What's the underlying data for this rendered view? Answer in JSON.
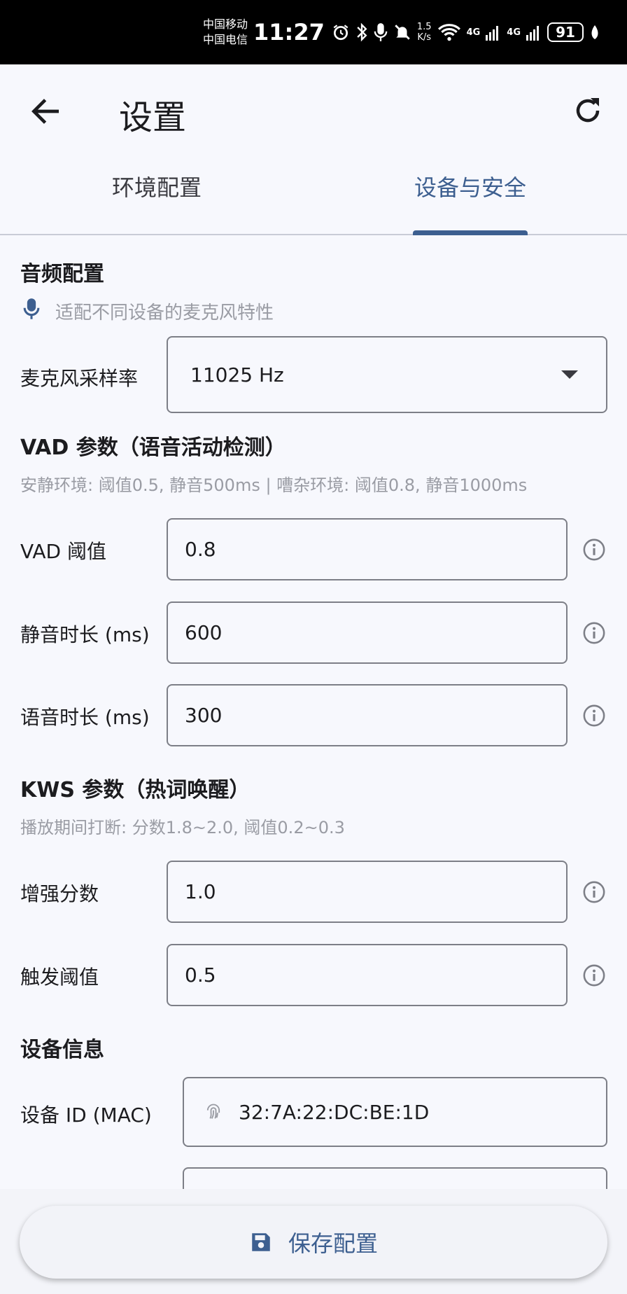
{
  "status_bar": {
    "carrier_1": "中国移动",
    "carrier_2": "中国电信",
    "time": "11:27",
    "net_speed_value": "1.5",
    "net_speed_unit": "K/s",
    "signal_1_label": "4G",
    "signal_2_label": "4G",
    "battery": "91"
  },
  "appbar": {
    "title": "设置"
  },
  "tabs": [
    {
      "label": "环境配置",
      "active": false
    },
    {
      "label": "设备与安全",
      "active": true
    }
  ],
  "audio": {
    "title": "音频配置",
    "hint": "适配不同设备的麦克风特性",
    "sample_rate_label": "麦克风采样率",
    "sample_rate_value": "11025 Hz"
  },
  "vad": {
    "title": "VAD 参数（语音活动检测）",
    "hint": "安静环境: 阈值0.5, 静音500ms | 嘈杂环境: 阈值0.8, 静音1000ms",
    "threshold_label": "VAD 阈值",
    "threshold_value": "0.8",
    "silence_label": "静音时长 (ms)",
    "silence_value": "600",
    "speech_label": "语音时长 (ms)",
    "speech_value": "300"
  },
  "kws": {
    "title": "KWS 参数（热词唤醒）",
    "hint": "播放期间打断: 分数1.8~2.0, 阈值0.2~0.3",
    "boost_label": "增强分数",
    "boost_value": "1.0",
    "trigger_label": "触发阈值",
    "trigger_value": "0.5"
  },
  "device": {
    "title": "设备信息",
    "id_label": "设备 ID (MAC)",
    "id_value": "32:7A:22:DC:BE:1D"
  },
  "save_button": {
    "label": "保存配置"
  },
  "colors": {
    "accent": "#3d5f90",
    "background": "#f7f8fd",
    "hint": "#9a9ca4",
    "border": "#7d7f87"
  }
}
